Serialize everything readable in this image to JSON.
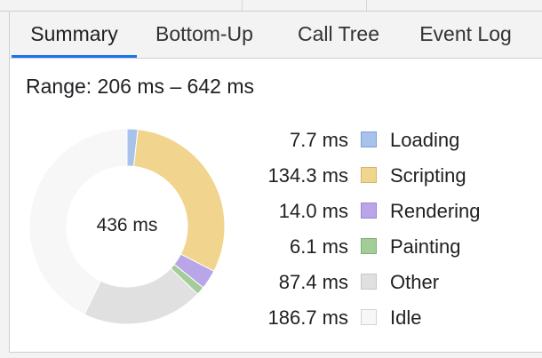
{
  "tabs": [
    {
      "label": "Summary",
      "active": true
    },
    {
      "label": "Bottom-Up",
      "active": false
    },
    {
      "label": "Call Tree",
      "active": false
    },
    {
      "label": "Event Log",
      "active": false
    }
  ],
  "range_text": "Range: 206 ms – 642 ms",
  "total_text": "436 ms",
  "categories": [
    {
      "value": "7.7 ms",
      "label": "Loading",
      "ms": 7.7,
      "color": "#a7c3eb",
      "border": "#7f9fd1"
    },
    {
      "value": "134.3 ms",
      "label": "Scripting",
      "ms": 134.3,
      "color": "#f1d48d",
      "border": "#d2b36a"
    },
    {
      "value": "14.0 ms",
      "label": "Rendering",
      "ms": 14.0,
      "color": "#b9a6e8",
      "border": "#9a84d4"
    },
    {
      "value": "6.1 ms",
      "label": "Painting",
      "ms": 6.1,
      "color": "#a4cc98",
      "border": "#7fb075"
    },
    {
      "value": "87.4 ms",
      "label": "Other",
      "ms": 87.4,
      "color": "#e0e0e0",
      "border": "#c7c7c7"
    },
    {
      "value": "186.7 ms",
      "label": "Idle",
      "ms": 186.7,
      "color": "#f7f7f7",
      "border": "#d4d4d4"
    }
  ]
}
